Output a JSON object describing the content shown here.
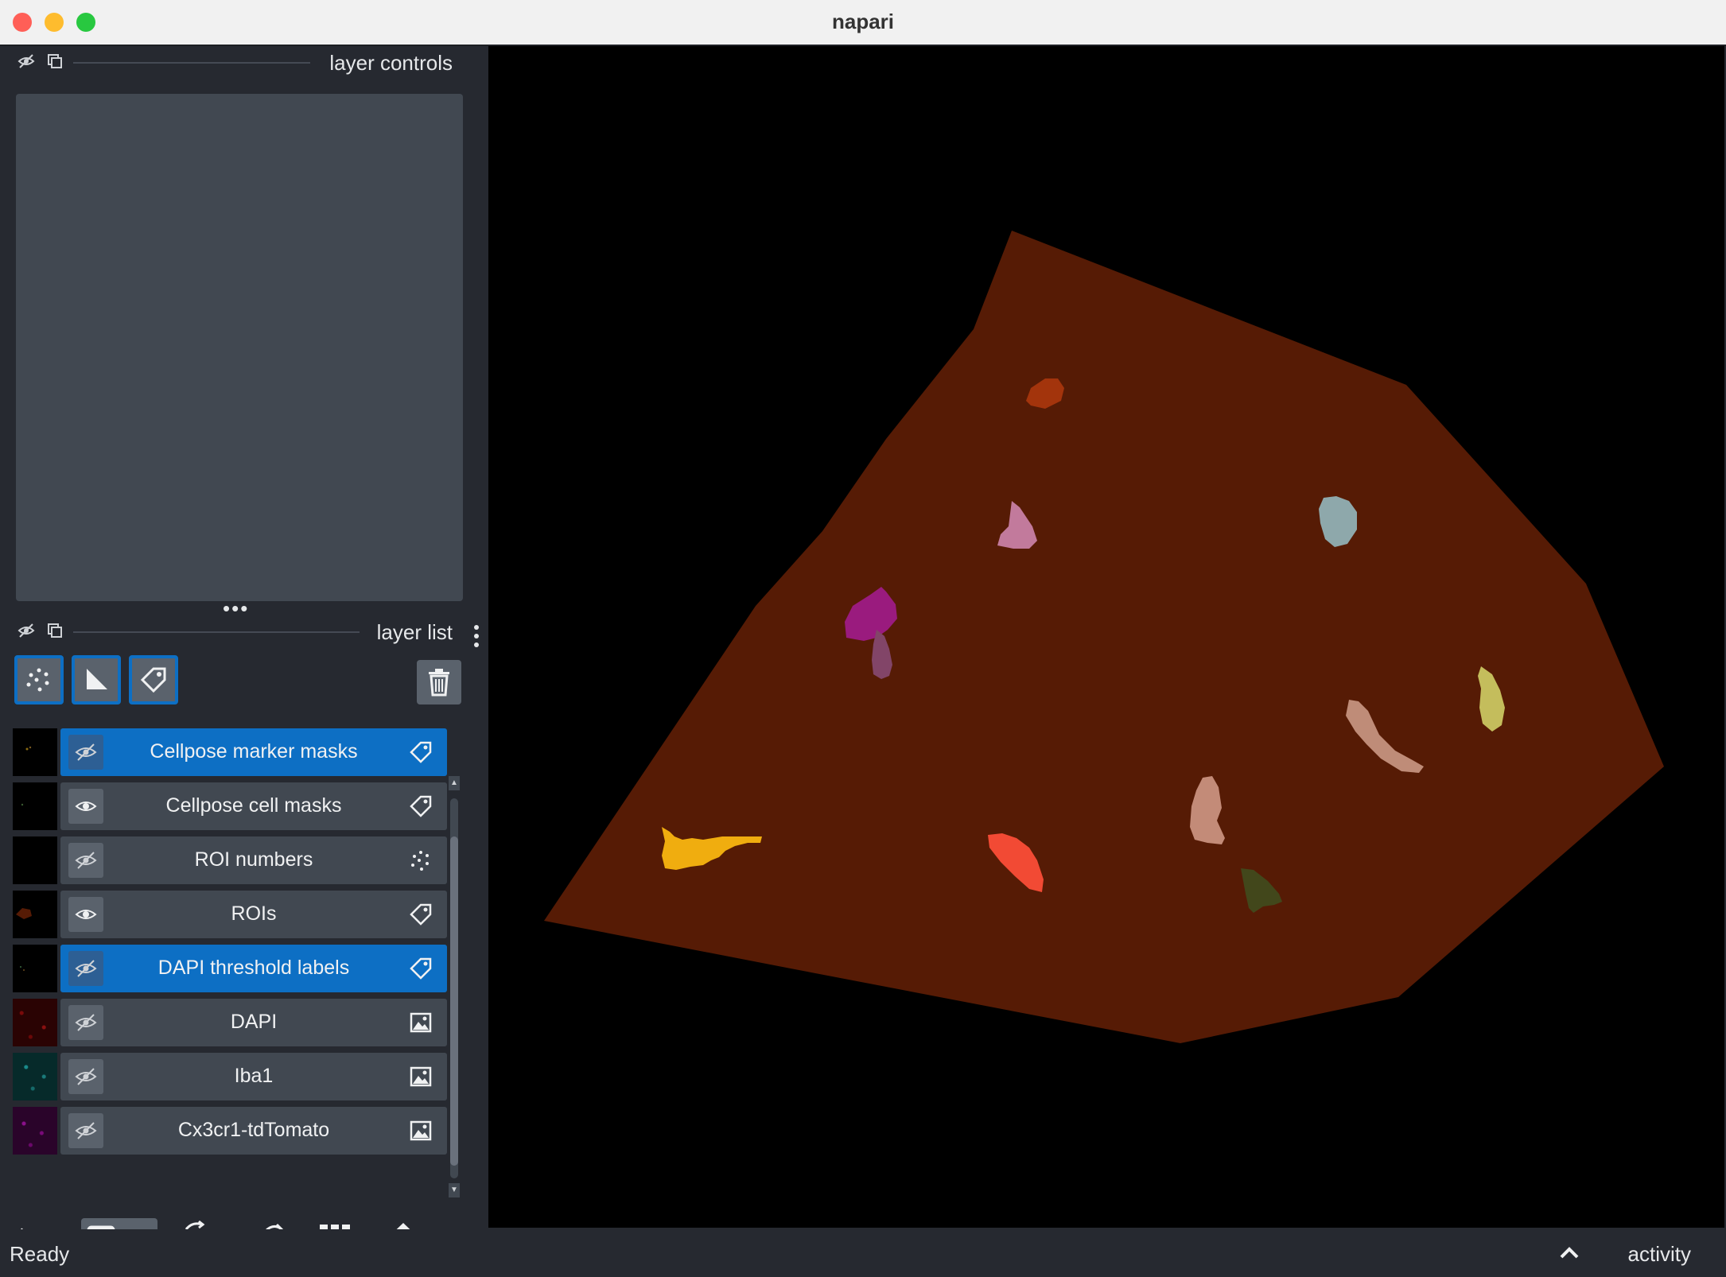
{
  "window": {
    "title": "napari"
  },
  "layer_controls": {
    "title": "layer controls"
  },
  "layer_list": {
    "title": "layer list",
    "layers": [
      {
        "name": "Cellpose marker masks",
        "type_icon": "labels-icon",
        "visible": false,
        "selected": true
      },
      {
        "name": "Cellpose cell masks",
        "type_icon": "labels-icon",
        "visible": true,
        "selected": false
      },
      {
        "name": "ROI numbers",
        "type_icon": "points-icon",
        "visible": false,
        "selected": false
      },
      {
        "name": "ROIs",
        "type_icon": "labels-icon",
        "visible": true,
        "selected": false
      },
      {
        "name": "DAPI threshold labels",
        "type_icon": "labels-icon",
        "visible": false,
        "selected": true
      },
      {
        "name": "DAPI",
        "type_icon": "image-icon",
        "visible": false,
        "selected": false
      },
      {
        "name": "Iba1",
        "type_icon": "image-icon",
        "visible": false,
        "selected": false
      },
      {
        "name": "Cx3cr1-tdTomato",
        "type_icon": "image-icon",
        "visible": false,
        "selected": false
      }
    ]
  },
  "new_layer_buttons": [
    "new-points-icon",
    "new-shapes-icon",
    "new-labels-icon"
  ],
  "bottom_buttons": [
    "console-icon",
    "ndisplay-2d-3d-icon",
    "roll-dims-icon",
    "transpose-dims-icon",
    "grid-view-icon",
    "home-icon"
  ],
  "status": {
    "text": "Ready",
    "activity": "activity"
  },
  "colors": {
    "accent": "#0d6fc4",
    "background": "#262930",
    "canvas": "#000000",
    "roi_fill": "#561b05"
  }
}
